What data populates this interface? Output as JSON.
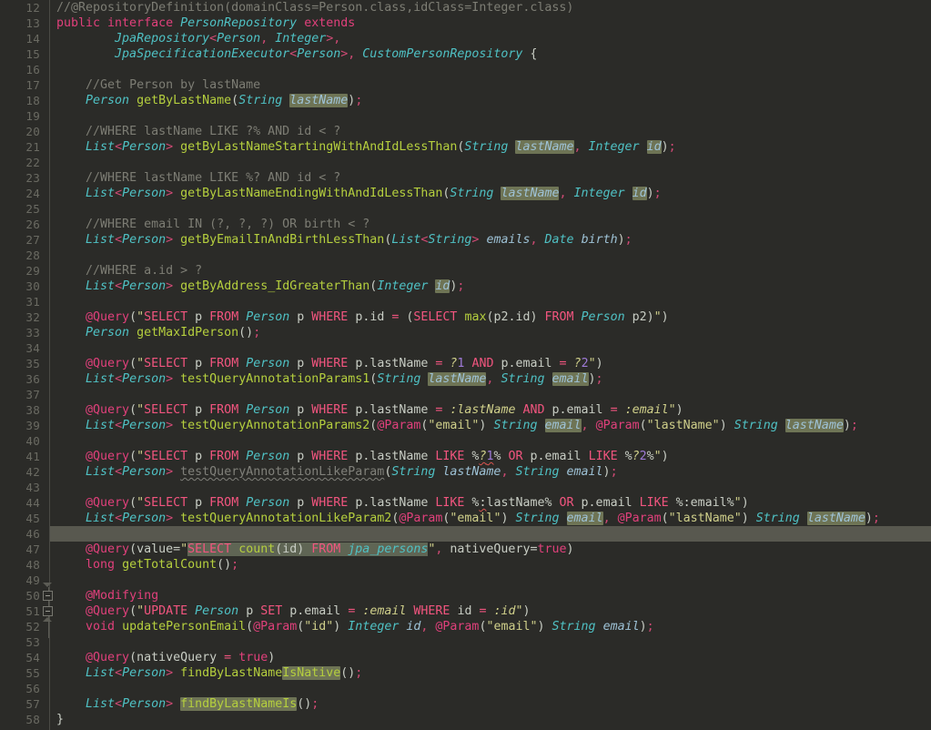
{
  "editor": {
    "language": "Java",
    "theme": "Darcula",
    "background": "#2b2b28",
    "gutter_background": "#2b2b28",
    "gutter_separator_color": "#4a4a45",
    "line_number_color": "#6a6a62",
    "caret_line_color": "#58584f",
    "caret_line_number": 46,
    "first_line_number": 12,
    "last_line_number": 58,
    "line_height_px": 17,
    "usage_highlight_color": "#6e7455",
    "injected_sql_highlight_color": "#5f6554",
    "error_squiggle_color": "#d9534f",
    "unused_squiggle_color": "#80807a"
  },
  "palette": {
    "keyword": "#e0407b",
    "class_name": "#4fc1c4",
    "method_name": "#b5cf3e",
    "comment": "#7d7d74",
    "string": "#cfcf8a",
    "sql_keyword": "#f2557f",
    "parameter": "#9ec2d6",
    "number_param": "#9f7bd8",
    "plain_text": "#c8cdc4",
    "punctuation": "#d14a75"
  },
  "fold_markers": [
    {
      "line": 50,
      "type": "collapse-box"
    },
    {
      "line": 51,
      "type": "collapse-box"
    }
  ],
  "line_numbers": [
    12,
    13,
    14,
    15,
    16,
    17,
    18,
    19,
    20,
    21,
    22,
    23,
    24,
    25,
    26,
    27,
    28,
    29,
    30,
    31,
    32,
    33,
    34,
    35,
    36,
    37,
    38,
    39,
    40,
    41,
    42,
    43,
    44,
    45,
    46,
    47,
    48,
    49,
    50,
    51,
    52,
    53,
    54,
    55,
    56,
    57,
    58
  ],
  "lines": {
    "12": "//@RepositoryDefinition(domainClass=Person.class,idClass=Integer.class)",
    "13": "public interface PersonRepository extends",
    "14": "    JpaRepository<Person, Integer>,",
    "15": "    JpaSpecificationExecutor<Person>, CustomPersonRepository {",
    "16": "",
    "17": "    //Get Person by lastName",
    "18": "    Person getByLastName(String lastName);",
    "19": "",
    "20": "    //WHERE lastName LIKE ?% AND id < ?",
    "21": "    List<Person> getByLastNameStartingWithAndIdLessThan(String lastName, Integer id);",
    "22": "",
    "23": "    //WHERE lastName LIKE %? AND id < ?",
    "24": "    List<Person> getByLastNameEndingWithAndIdLessThan(String lastName, Integer id);",
    "25": "",
    "26": "    //WHERE email IN (?, ?, ?) OR birth < ?",
    "27": "    List<Person> getByEmailInAndBirthLessThan(List<String> emails, Date birth);",
    "28": "",
    "29": "    //WHERE a.id > ?",
    "30": "    List<Person> getByAddress_IdGreaterThan(Integer id);",
    "31": "",
    "32": "    @Query(\"SELECT p FROM Person p WHERE p.id = (SELECT max(p2.id) FROM Person p2)\")",
    "33": "    Person getMaxIdPerson();",
    "34": "",
    "35": "    @Query(\"SELECT p FROM Person p WHERE p.lastName = ?1 AND p.email = ?2\")",
    "36": "    List<Person> testQueryAnnotationParams1(String lastName, String email);",
    "37": "",
    "38": "    @Query(\"SELECT p FROM Person p WHERE p.lastName = :lastName AND p.email = :email\")",
    "39": "    List<Person> testQueryAnnotationParams2(@Param(\"email\") String email, @Param(\"lastName\") String lastName);",
    "40": "",
    "41": "    @Query(\"SELECT p FROM Person p WHERE p.lastName LIKE %?1% OR p.email LIKE %?2%\")",
    "42": "    List<Person> testQueryAnnotationLikeParam(String lastName, String email);",
    "43": "",
    "44": "    @Query(\"SELECT p FROM Person p WHERE p.lastName LIKE %:lastName% OR p.email LIKE %:email%\")",
    "45": "    List<Person> testQueryAnnotationLikeParam2(@Param(\"email\") String email, @Param(\"lastName\") String lastName);",
    "46": "",
    "47": "    @Query(value=\"SELECT count(id) FROM jpa_persons\", nativeQuery=true)",
    "48": "    long getTotalCount();",
    "49": "",
    "50": "    @Modifying",
    "51": "    @Query(\"UPDATE Person p SET p.email = :email WHERE id = :id\")",
    "52": "    void updatePersonEmail(@Param(\"id\") Integer id, @Param(\"email\") String email);",
    "53": "",
    "54": "    @Query(nativeQuery = true)",
    "55": "    List<Person> findByLastNameIsNative();",
    "56": "",
    "57": "    List<Person> findByLastNameIs();",
    "58": "}"
  }
}
